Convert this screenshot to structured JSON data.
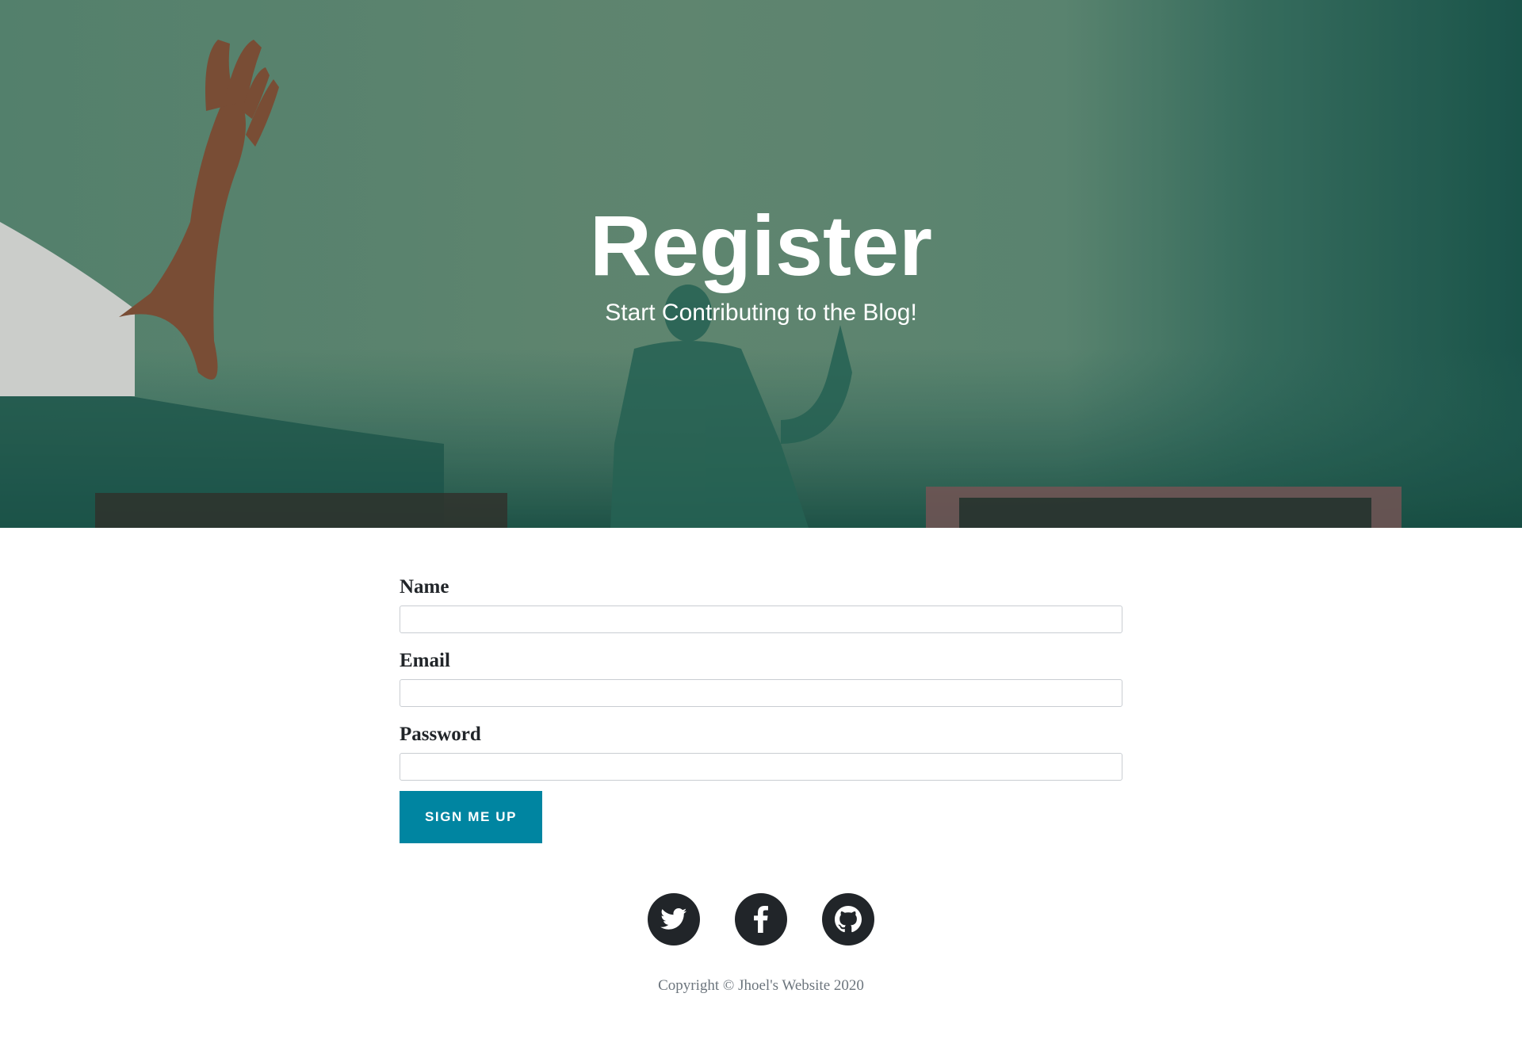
{
  "hero": {
    "title": "Register",
    "subtitle": "Start Contributing to the Blog!",
    "background_color": "#5f8b73"
  },
  "form": {
    "name_label": "Name",
    "name_value": "",
    "email_label": "Email",
    "email_value": "",
    "password_label": "Password",
    "password_value": "",
    "submit_label": "SIGN ME UP",
    "accent_color": "#0085a1"
  },
  "footer": {
    "social": [
      {
        "name": "twitter",
        "icon": "twitter-icon"
      },
      {
        "name": "facebook",
        "icon": "facebook-icon"
      },
      {
        "name": "github",
        "icon": "github-icon"
      }
    ],
    "copyright": "Copyright © Jhoel's Website 2020"
  }
}
